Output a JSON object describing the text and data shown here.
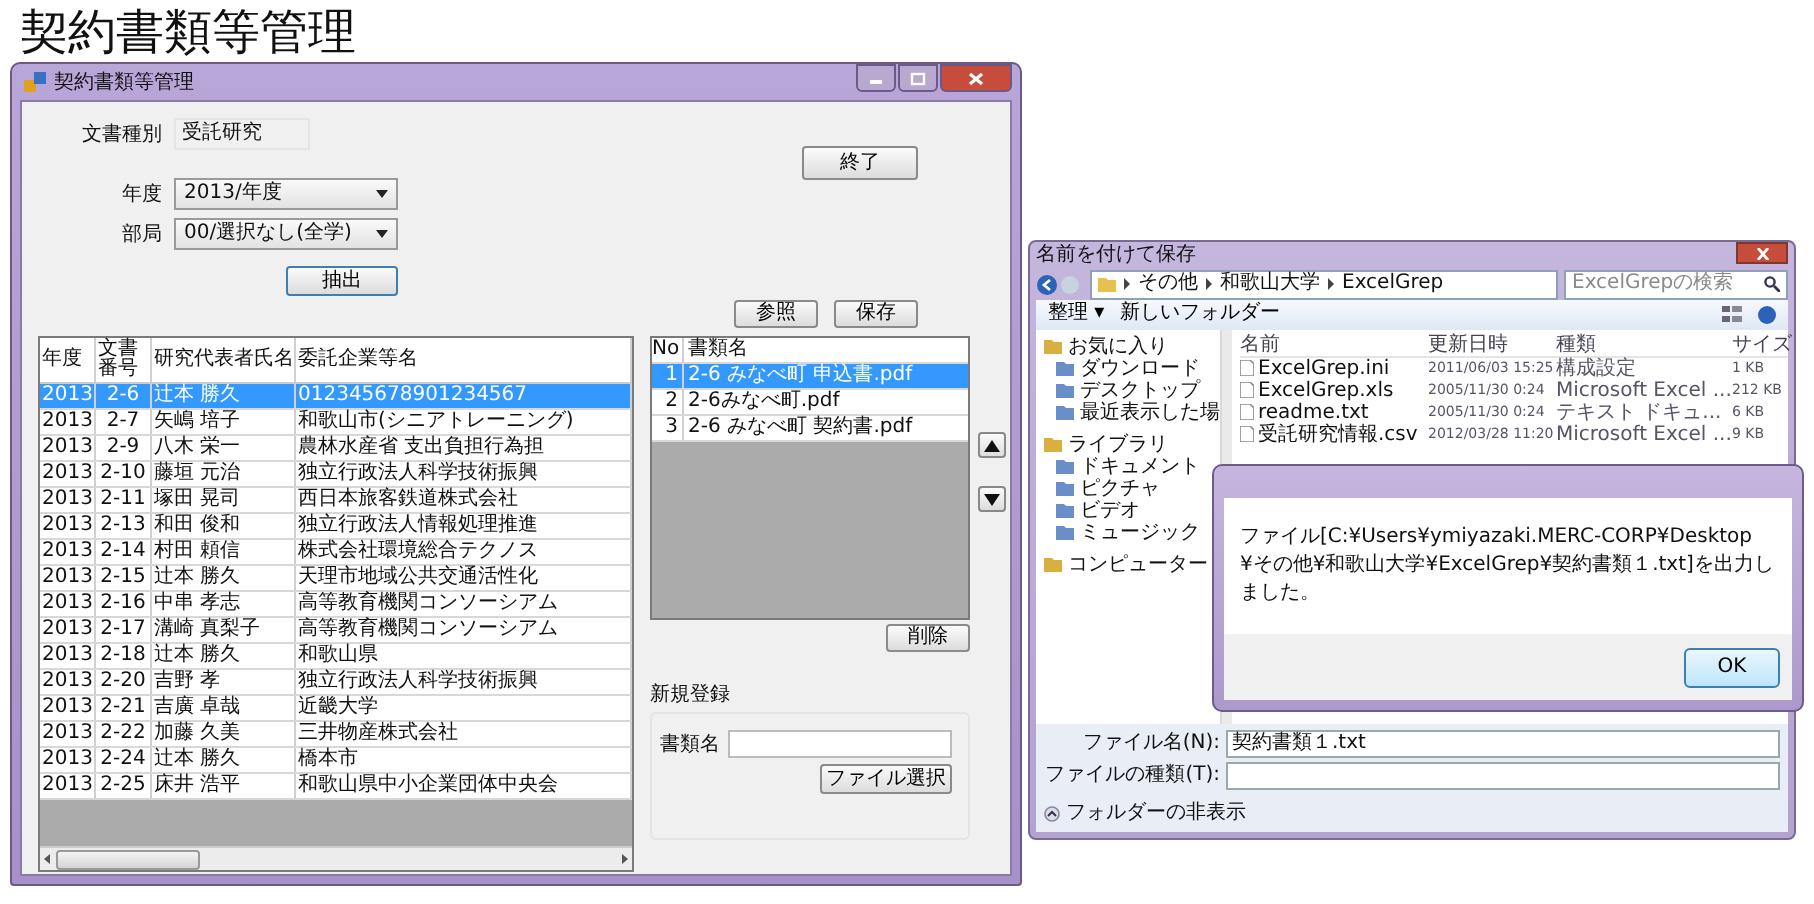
{
  "page_title": "契約書類等管理",
  "main_window": {
    "title": "契約書類等管理",
    "document_type": {
      "label": "文書種別",
      "value": "受託研究"
    },
    "exit_button": "終了",
    "year": {
      "label": "年度",
      "value": "2013/年度"
    },
    "department": {
      "label": "部局",
      "value": "00/選択なし(全学)"
    },
    "extract_button": "抽出",
    "browse_button": "参照",
    "save_button": "保存",
    "contracts_table": {
      "columns": [
        "年度",
        "文書番号",
        "研究代表者氏名",
        "委託企業等名"
      ],
      "rows": [
        {
          "cells": [
            "2013",
            "2-6",
            "辻本 勝久",
            "012345678901234567"
          ],
          "selected": true
        },
        {
          "cells": [
            "2013",
            "2-7",
            "矢嶋 培子",
            "和歌山市(シニアトレーニング)"
          ],
          "selected": false
        },
        {
          "cells": [
            "2013",
            "2-9",
            "八木 栄一",
            "農林水産省 支出負担行為担"
          ],
          "selected": false
        },
        {
          "cells": [
            "2013",
            "2-10",
            "藤垣 元治",
            "独立行政法人科学技術振興"
          ],
          "selected": false
        },
        {
          "cells": [
            "2013",
            "2-11",
            "塚田 晃司",
            "西日本旅客鉄道株式会社"
          ],
          "selected": false
        },
        {
          "cells": [
            "2013",
            "2-13",
            "和田 俊和",
            "独立行政法人情報処理推進"
          ],
          "selected": false
        },
        {
          "cells": [
            "2013",
            "2-14",
            "村田 頼信",
            "株式会社環境総合テクノス"
          ],
          "selected": false
        },
        {
          "cells": [
            "2013",
            "2-15",
            "辻本 勝久",
            "天理市地域公共交通活性化"
          ],
          "selected": false
        },
        {
          "cells": [
            "2013",
            "2-16",
            "中串 孝志",
            "高等教育機関コンソーシアム"
          ],
          "selected": false
        },
        {
          "cells": [
            "2013",
            "2-17",
            "溝崎 真梨子",
            "高等教育機関コンソーシアム"
          ],
          "selected": false
        },
        {
          "cells": [
            "2013",
            "2-18",
            "辻本 勝久",
            "和歌山県"
          ],
          "selected": false
        },
        {
          "cells": [
            "2013",
            "2-20",
            "吉野 孝",
            "独立行政法人科学技術振興"
          ],
          "selected": false
        },
        {
          "cells": [
            "2013",
            "2-21",
            "吉廣 卓哉",
            "近畿大学"
          ],
          "selected": false
        },
        {
          "cells": [
            "2013",
            "2-22",
            "加藤 久美",
            "三井物産株式会社"
          ],
          "selected": false
        },
        {
          "cells": [
            "2013",
            "2-24",
            "辻本 勝久",
            "橋本市"
          ],
          "selected": false
        },
        {
          "cells": [
            "2013",
            "2-25",
            "床井 浩平",
            "和歌山県中小企業団体中央会"
          ],
          "selected": false
        }
      ]
    },
    "files_list": {
      "columns": [
        "No",
        "書類名"
      ],
      "rows": [
        {
          "no": "1",
          "name": "2-6 みなべ町 申込書.pdf",
          "selected": true
        },
        {
          "no": "2",
          "name": "2-6みなべ町.pdf",
          "selected": false
        },
        {
          "no": "3",
          "name": "2-6 みなべ町 契約書.pdf",
          "selected": false
        }
      ]
    },
    "delete_button": "削除",
    "new_registration": {
      "title": "新規登録",
      "doc_name_label": "書類名",
      "select_file_button": "ファイル選択"
    }
  },
  "save_dialog": {
    "title": "名前を付けて保存",
    "breadcrumbs": [
      "その他",
      "和歌山大学",
      "ExcelGrep"
    ],
    "search_placeholder": "ExcelGrepの検索",
    "organize_button": "整理 ▾",
    "new_folder_button": "新しいフォルダー",
    "sidebar": [
      {
        "label": "お気に入り",
        "children": [
          {
            "label": "ダウンロード"
          },
          {
            "label": "デスクトップ"
          },
          {
            "label": "最近表示した場"
          }
        ]
      },
      {
        "label": "ライブラリ",
        "children": [
          {
            "label": "ドキュメント"
          },
          {
            "label": "ピクチャ"
          },
          {
            "label": "ビデオ"
          },
          {
            "label": "ミュージック"
          }
        ]
      },
      {
        "label": "コンピューター"
      }
    ],
    "columns": [
      "名前",
      "更新日時",
      "種類",
      "サイズ"
    ],
    "files": [
      {
        "name": "ExcelGrep.ini",
        "modified": "2011/06/03 15:25",
        "type": "構成設定",
        "size": "1 KB"
      },
      {
        "name": "ExcelGrep.xls",
        "modified": "2005/11/30 0:24",
        "type": "Microsoft Excel ...",
        "size": "212 KB"
      },
      {
        "name": "readme.txt",
        "modified": "2005/11/30 0:24",
        "type": "テキスト ドキュ...",
        "size": "6 KB"
      },
      {
        "name": "受託研究情報.csv",
        "modified": "2012/03/28 11:20",
        "type": "Microsoft Excel ...",
        "size": "9 KB"
      }
    ],
    "file_name": {
      "label": "ファイル名(N):",
      "value": "契約書類１.txt"
    },
    "file_type": {
      "label": "ファイルの種類(T):"
    },
    "hide_folders": "フォルダーの非表示"
  },
  "message_dialog": {
    "text": "ファイル[C:¥Users¥ymiyazaki.MERC-CORP¥Desktop¥その他¥和歌山大学¥ExcelGrep¥契約書類１.txt]を出力しました。",
    "ok_button": "OK"
  }
}
